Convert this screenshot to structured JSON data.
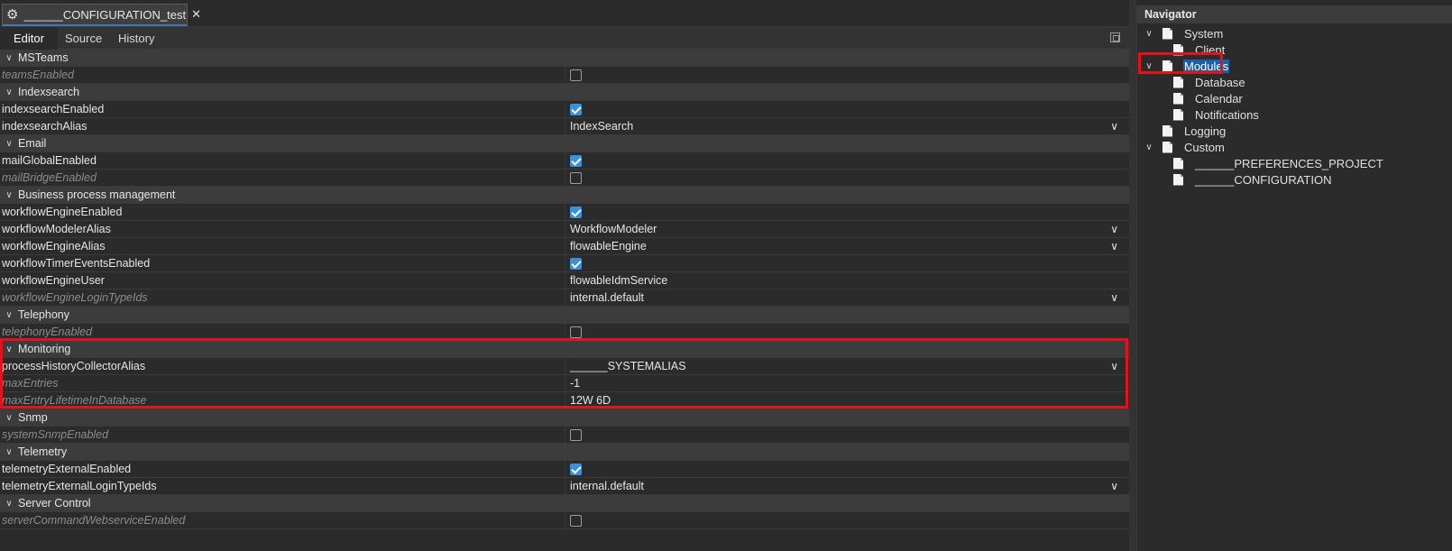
{
  "editor": {
    "tab_title": "______CONFIGURATION_test",
    "subtabs": [
      "Editor",
      "Source",
      "History"
    ],
    "rows": [
      {
        "type": "header",
        "label": "MSTeams"
      },
      {
        "type": "prop",
        "name": "teamsEnabled",
        "inherited": true,
        "kind": "checkbox",
        "checked": false
      },
      {
        "type": "header",
        "label": "Indexsearch"
      },
      {
        "type": "prop",
        "name": "indexsearchEnabled",
        "inherited": false,
        "kind": "checkbox",
        "checked": true
      },
      {
        "type": "prop",
        "name": "indexsearchAlias",
        "inherited": false,
        "kind": "dropdown",
        "value": "IndexSearch"
      },
      {
        "type": "header",
        "label": "Email"
      },
      {
        "type": "prop",
        "name": "mailGlobalEnabled",
        "inherited": false,
        "kind": "checkbox",
        "checked": true
      },
      {
        "type": "prop",
        "name": "mailBridgeEnabled",
        "inherited": true,
        "kind": "checkbox",
        "checked": false
      },
      {
        "type": "header",
        "label": "Business process management"
      },
      {
        "type": "prop",
        "name": "workflowEngineEnabled",
        "inherited": false,
        "kind": "checkbox",
        "checked": true
      },
      {
        "type": "prop",
        "name": "workflowModelerAlias",
        "inherited": false,
        "kind": "dropdown",
        "value": "WorkflowModeler"
      },
      {
        "type": "prop",
        "name": "workflowEngineAlias",
        "inherited": false,
        "kind": "dropdown",
        "value": "flowableEngine"
      },
      {
        "type": "prop",
        "name": "workflowTimerEventsEnabled",
        "inherited": false,
        "kind": "checkbox",
        "checked": true
      },
      {
        "type": "prop",
        "name": "workflowEngineUser",
        "inherited": false,
        "kind": "text",
        "value": "flowableIdmService"
      },
      {
        "type": "prop",
        "name": "workflowEngineLoginTypeIds",
        "inherited": true,
        "kind": "dropdown",
        "value": "internal.default"
      },
      {
        "type": "header",
        "label": "Telephony"
      },
      {
        "type": "prop",
        "name": "telephonyEnabled",
        "inherited": true,
        "kind": "checkbox",
        "checked": false
      },
      {
        "type": "header",
        "label": "Monitoring"
      },
      {
        "type": "prop",
        "name": "processHistoryCollectorAlias",
        "inherited": false,
        "kind": "dropdown",
        "value": "______SYSTEMALIAS"
      },
      {
        "type": "prop",
        "name": "maxEntries",
        "inherited": true,
        "kind": "text",
        "value": "-1"
      },
      {
        "type": "prop",
        "name": "maxEntryLifetimeInDatabase",
        "inherited": true,
        "kind": "text",
        "value": "12W 6D"
      },
      {
        "type": "header",
        "label": "Snmp"
      },
      {
        "type": "prop",
        "name": "systemSnmpEnabled",
        "inherited": true,
        "kind": "checkbox",
        "checked": false
      },
      {
        "type": "header",
        "label": "Telemetry"
      },
      {
        "type": "prop",
        "name": "telemetryExternalEnabled",
        "inherited": false,
        "kind": "checkbox",
        "checked": true
      },
      {
        "type": "prop",
        "name": "telemetryExternalLoginTypeIds",
        "inherited": false,
        "kind": "dropdown",
        "value": "internal.default"
      },
      {
        "type": "header",
        "label": "Server Control"
      },
      {
        "type": "prop",
        "name": "serverCommandWebserviceEnabled",
        "inherited": true,
        "kind": "checkbox",
        "checked": false
      }
    ]
  },
  "navigator": {
    "title": "Navigator",
    "items": [
      {
        "label": "System",
        "depth": 0,
        "expanded": true,
        "selected": false
      },
      {
        "label": "Client",
        "depth": 1,
        "expanded": null,
        "selected": false
      },
      {
        "label": "Modules",
        "depth": 0,
        "expanded": true,
        "selected": true
      },
      {
        "label": "Database",
        "depth": 1,
        "expanded": null,
        "selected": false
      },
      {
        "label": "Calendar",
        "depth": 1,
        "expanded": null,
        "selected": false
      },
      {
        "label": "Notifications",
        "depth": 1,
        "expanded": null,
        "selected": false
      },
      {
        "label": "Logging",
        "depth": 0,
        "expanded": null,
        "selected": false
      },
      {
        "label": "Custom",
        "depth": 0,
        "expanded": true,
        "selected": false
      },
      {
        "label": "______PREFERENCES_PROJECT",
        "depth": 1,
        "expanded": null,
        "selected": false
      },
      {
        "label": "______CONFIGURATION",
        "depth": 1,
        "expanded": null,
        "selected": false
      }
    ]
  },
  "icons": {
    "tab_icon": "gear-icon",
    "tab_close": "close-icon",
    "section_toggle": "chevron-down-icon",
    "dropdown": "chevron-down-icon",
    "tree_node": "page-icon"
  },
  "colors": {
    "accent": "#3d8fd6",
    "selection": "#1f5ea8",
    "highlight_box": "#e2131b"
  }
}
